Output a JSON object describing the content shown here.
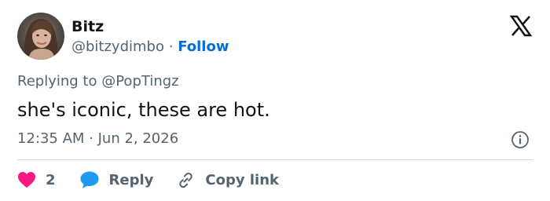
{
  "tweet": {
    "author": {
      "name": "Bitz",
      "handle": "@bitzydimbo",
      "separator": "·",
      "follow_label": "Follow"
    },
    "replying_to_prefix": "Replying to",
    "replying_to_handle": "@PopTingz",
    "text": "she's iconic, these are hot.",
    "timestamp": "12:35 AM · Jun 2, 2026",
    "likes_count": "2",
    "reply_label": "Reply",
    "copy_link_label": "Copy link"
  },
  "colors": {
    "text": "#0f1419",
    "secondary": "#536471",
    "follow": "#006fd6",
    "heart": "#f91880",
    "reply_bubble": "#1d9bf0",
    "divider": "#cfd9de"
  },
  "icons": {
    "brand": "x-logo-icon",
    "info": "info-icon",
    "like": "heart-icon",
    "reply": "speech-bubble-icon",
    "copy": "link-icon"
  }
}
